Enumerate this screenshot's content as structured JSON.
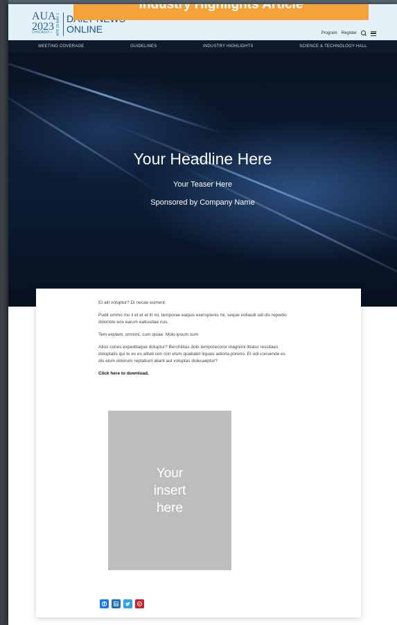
{
  "banner": {
    "text": "Industry Highlights Article"
  },
  "header": {
    "logo": {
      "aua": "AUA",
      "year": "2023",
      "city": "CHICAGO •",
      "dates": "APR 28-MAY 1",
      "title_line1": "DAILY NEWS",
      "title_line2": "ONLINE"
    },
    "links": {
      "program": "Program",
      "register": "Register"
    },
    "icons": {
      "search": "search-icon",
      "menu": "menu-icon"
    }
  },
  "nav": {
    "items": [
      {
        "label": "MEETING COVERAGE"
      },
      {
        "label": "GUIDELINES"
      },
      {
        "label": "INDUSTRY HIGHLIGHTS"
      },
      {
        "label": "SCIENCE & TECHNOLOGY HALL"
      }
    ]
  },
  "hero": {
    "headline": "Your Headline Here",
    "teaser": "Your Teaser Here",
    "sponsor": "Sponsored by Company Name"
  },
  "article": {
    "paragraphs": [
      "Et alit voluptur? Di necae eument.",
      "Pudit ommo mo il et et et lit mi, temporae eaquis exerspienis mi, seque vollaudi odi dis repedio doloriste eos earum eatiusdae nus.",
      "Tem explant, omnimi, cum quiae. Molo ipsum sum",
      "Atios cones expeditaque doluptur? Berchilitas dolo temporecoror magnimi litiatur ressitaes doluptatis qui te es es alitati con con etum quatiatet liquasi adioria porerio. Et odi consende es dis eium dolorum reptatiunt aliant aut voluptas dolecaeptur?"
    ],
    "download": "Click here to download.",
    "insert": "Your\ninsert\nhere"
  },
  "share": {
    "icons": [
      "facebook-icon",
      "linkedin-icon",
      "twitter-icon",
      "pinterest-icon"
    ]
  },
  "colors": {
    "banner": "#f6a23a",
    "header_bg": "#e3f1f8",
    "nav_bg": "#0e1a2b",
    "insert_bg": "#bdbdbd"
  }
}
